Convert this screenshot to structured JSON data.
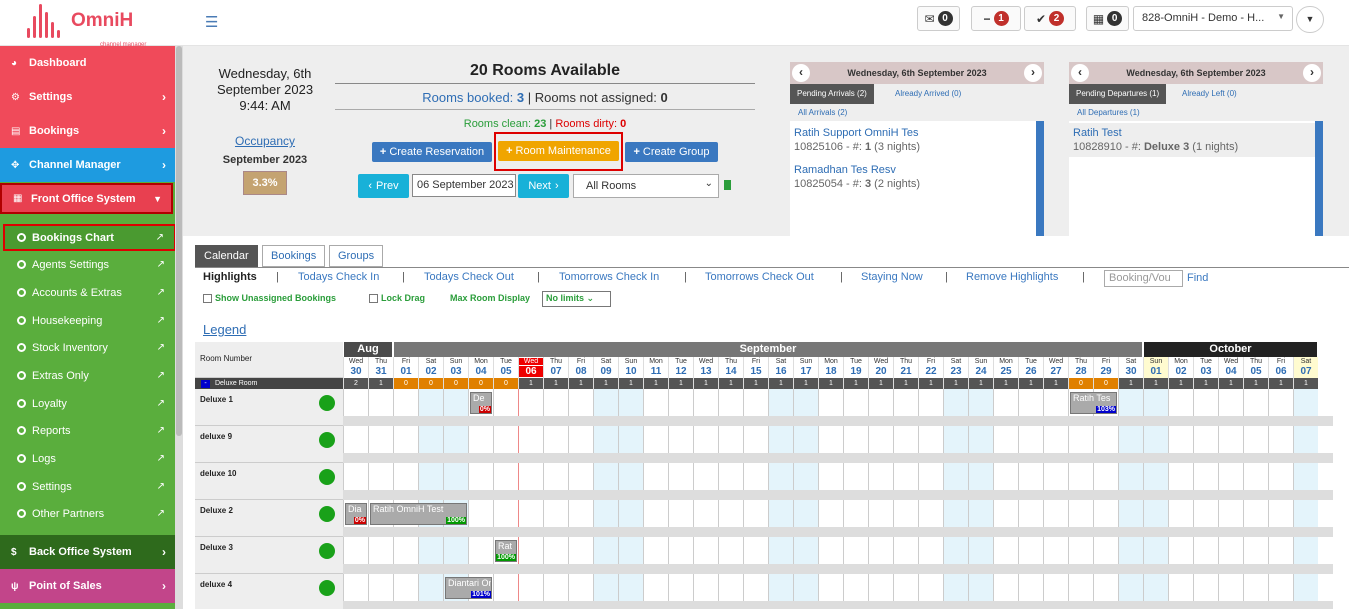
{
  "brand": {
    "name": "OmniH",
    "tagline": "channel manager"
  },
  "topbar": {
    "messages_count": "0",
    "minus_count": "1",
    "check_count": "2",
    "calendar_count": "0",
    "hotel_select": "828-OmniH - Demo - H...",
    "colors": {
      "brand": "#e84a5f",
      "badge_dark": "#333333",
      "badge_red": "#c0302b"
    }
  },
  "sidebar": {
    "items": [
      {
        "label": "Dashboard",
        "icon": "dashboard-icon"
      },
      {
        "label": "Settings",
        "icon": "gear-icon"
      },
      {
        "label": "Bookings",
        "icon": "bookings-icon"
      },
      {
        "label": "Channel Manager",
        "icon": "arrows-icon"
      },
      {
        "label": "Front Office System",
        "icon": "calendar-icon"
      }
    ],
    "sub_items": [
      "Bookings Chart",
      "Agents Settings",
      "Accounts & Extras",
      "Housekeeping",
      "Stock Inventory",
      "Extras Only",
      "Loyalty",
      "Reports",
      "Logs",
      "Settings",
      "Other Partners"
    ],
    "bottom_items": [
      {
        "label": "Back Office System",
        "icon": "dollar-icon"
      },
      {
        "label": "Point of Sales",
        "icon": "cutlery-icon"
      }
    ]
  },
  "summary": {
    "date_line1": "Wednesday, 6th",
    "date_line2": "September 2023",
    "time": "9:44: AM",
    "occupancy_link": "Occupancy",
    "occupancy_month": "September 2023",
    "occupancy_pct": "3.3%",
    "rooms_available": "20 Rooms Available",
    "rooms_booked_label": "Rooms booked:",
    "rooms_booked": "3",
    "rooms_not_assigned_label": "Rooms not assigned:",
    "rooms_not_assigned": "0",
    "rooms_clean_label": "Rooms clean:",
    "rooms_clean": "23",
    "rooms_dirty_label": "Rooms dirty:",
    "rooms_dirty": "0"
  },
  "actions": {
    "create_reservation": "Create Reservation",
    "room_maintenance": "Room Maintenance",
    "create_group": "Create Group",
    "prev": "Prev",
    "next": "Next",
    "date_value": "06 September 2023",
    "rooms_filter": "All Rooms"
  },
  "arrivals": {
    "date": "Wednesday, 6th September 2023",
    "tab_pending": "Pending Arrivals (2)",
    "tab_done": "Already Arrived (0)",
    "all": "All Arrivals (2)",
    "items": [
      {
        "name": "Ratih Support OmniH Tes",
        "ref": "10825106",
        "room": "1",
        "nights": "(3 nights)"
      },
      {
        "name": "Ramadhan Tes Resv",
        "ref": "10825054",
        "room": "3",
        "nights": "(2 nights)"
      }
    ]
  },
  "departures": {
    "date": "Wednesday, 6th September 2023",
    "tab_pending": "Pending Departures (1)",
    "tab_done": "Already Left (0)",
    "all": "All Departures (1)",
    "items": [
      {
        "name": "Ratih Test",
        "ref": "10828910",
        "room": "Deluxe 3",
        "nights": "(1 nights)"
      }
    ]
  },
  "tabs": [
    "Calendar",
    "Bookings",
    "Groups"
  ],
  "highlights": {
    "label": "Highlights",
    "links": [
      "Todays Check In",
      "Todays Check Out",
      "Tomorrows Check In",
      "Tomorrows Check Out",
      "Staying Now",
      "Remove Highlights"
    ],
    "search_placeholder": "Booking/Vou",
    "find": "Find"
  },
  "options": {
    "show_unassigned": "Show Unassigned Bookings",
    "lock_drag": "Lock Drag",
    "max_room_label": "Max Room Display",
    "max_room_value": "No limits"
  },
  "legend": "Legend",
  "calendar": {
    "room_header": "Room Number",
    "group_label": "Deluxe Room",
    "months": [
      "Aug",
      "September",
      "October"
    ],
    "days": [
      {
        "w": "Wed",
        "d": "30",
        "c": "2"
      },
      {
        "w": "Thu",
        "d": "31",
        "c": "1"
      },
      {
        "w": "Fri",
        "d": "01",
        "c": "0"
      },
      {
        "w": "Sat",
        "d": "02",
        "c": "0"
      },
      {
        "w": "Sun",
        "d": "03",
        "c": "0"
      },
      {
        "w": "Mon",
        "d": "04",
        "c": "0"
      },
      {
        "w": "Tue",
        "d": "05",
        "c": "0"
      },
      {
        "w": "Wed",
        "d": "06",
        "c": "1"
      },
      {
        "w": "Thu",
        "d": "07",
        "c": "1"
      },
      {
        "w": "Fri",
        "d": "08",
        "c": "1"
      },
      {
        "w": "Sat",
        "d": "09",
        "c": "1"
      },
      {
        "w": "Sun",
        "d": "10",
        "c": "1"
      },
      {
        "w": "Mon",
        "d": "11",
        "c": "1"
      },
      {
        "w": "Tue",
        "d": "12",
        "c": "1"
      },
      {
        "w": "Wed",
        "d": "13",
        "c": "1"
      },
      {
        "w": "Thu",
        "d": "14",
        "c": "1"
      },
      {
        "w": "Fri",
        "d": "15",
        "c": "1"
      },
      {
        "w": "Sat",
        "d": "16",
        "c": "1"
      },
      {
        "w": "Sun",
        "d": "17",
        "c": "1"
      },
      {
        "w": "Mon",
        "d": "18",
        "c": "1"
      },
      {
        "w": "Tue",
        "d": "19",
        "c": "1"
      },
      {
        "w": "Wed",
        "d": "20",
        "c": "1"
      },
      {
        "w": "Thu",
        "d": "21",
        "c": "1"
      },
      {
        "w": "Fri",
        "d": "22",
        "c": "1"
      },
      {
        "w": "Sat",
        "d": "23",
        "c": "1"
      },
      {
        "w": "Sun",
        "d": "24",
        "c": "1"
      },
      {
        "w": "Mon",
        "d": "25",
        "c": "1"
      },
      {
        "w": "Tue",
        "d": "26",
        "c": "1"
      },
      {
        "w": "Wed",
        "d": "27",
        "c": "1"
      },
      {
        "w": "Thu",
        "d": "28",
        "c": "0"
      },
      {
        "w": "Fri",
        "d": "29",
        "c": "0"
      },
      {
        "w": "Sat",
        "d": "30",
        "c": "1"
      },
      {
        "w": "Sun",
        "d": "01",
        "c": "1"
      },
      {
        "w": "Mon",
        "d": "02",
        "c": "1"
      },
      {
        "w": "Tue",
        "d": "03",
        "c": "1"
      },
      {
        "w": "Wed",
        "d": "04",
        "c": "1"
      },
      {
        "w": "Thu",
        "d": "05",
        "c": "1"
      },
      {
        "w": "Fri",
        "d": "06",
        "c": "1"
      },
      {
        "w": "Sat",
        "d": "07",
        "c": "1"
      }
    ],
    "rooms": [
      "Deluxe 1",
      "deluxe 9",
      "deluxe 10",
      "Deluxe 2",
      "Deluxe 3",
      "deluxe 4"
    ],
    "bookings": [
      {
        "room": 0,
        "start": 5,
        "len": 1,
        "label": "De",
        "pct": "0%",
        "pc": "red"
      },
      {
        "room": 0,
        "start": 29,
        "len": 2,
        "label": "Ratih Tes",
        "pct": "103%",
        "pc": "blu"
      },
      {
        "room": 3,
        "start": 0,
        "len": 1,
        "label": "Dia",
        "pct": "0%",
        "pc": "red"
      },
      {
        "room": 3,
        "start": 1,
        "len": 4,
        "label": "Ratih OmniH Test",
        "pct": "100%",
        "pc": "grn"
      },
      {
        "room": 4,
        "start": 6,
        "len": 1,
        "label": "Rat",
        "pct": "100%",
        "pc": "grn"
      },
      {
        "room": 5,
        "start": 4,
        "len": 2,
        "label": "Diantari Om",
        "pct": "101%",
        "pc": "blu"
      }
    ]
  }
}
